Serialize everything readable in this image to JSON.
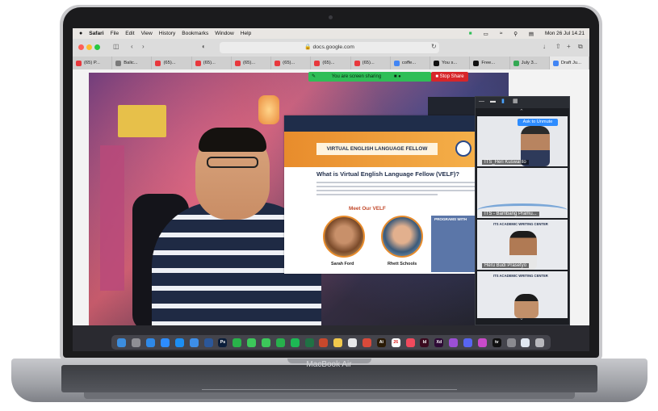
{
  "menubar": {
    "apple": "",
    "items": [
      "Safari",
      "File",
      "Edit",
      "View",
      "History",
      "Bookmarks",
      "Window",
      "Help"
    ],
    "datetime": "Mon 26 Jul  14.21"
  },
  "browser": {
    "url": "docs.google.com",
    "tabs": [
      {
        "label": "(65) P...",
        "icon_color": "#e8383d"
      },
      {
        "label": "Balic...",
        "icon_color": "#7a7a7a"
      },
      {
        "label": "(65)...",
        "icon_color": "#e8383d"
      },
      {
        "label": "(65)...",
        "icon_color": "#e8383d"
      },
      {
        "label": "(65)...",
        "icon_color": "#e8383d"
      },
      {
        "label": "(65)...",
        "icon_color": "#e8383d"
      },
      {
        "label": "(65)...",
        "icon_color": "#e8383d"
      },
      {
        "label": "(65)...",
        "icon_color": "#e8383d"
      },
      {
        "label": "coffe...",
        "icon_color": "#4285f4"
      },
      {
        "label": "You s...",
        "icon_color": "#111111"
      },
      {
        "label": "Free...",
        "icon_color": "#111111"
      },
      {
        "label": "July 3...",
        "icon_color": "#34a853"
      },
      {
        "label": "Draft Ju...",
        "icon_color": "#4285f4"
      }
    ]
  },
  "share": {
    "status": "You are screen sharing",
    "stop_label": "Stop Share"
  },
  "slide": {
    "banner_title": "VIRTUAL ENGLISH LANGUAGE FELLOW",
    "question": "What is Virtual English Language Fellow (VELF)?",
    "meet_heading": "Meet Our VELF",
    "fellows": [
      "Sarah Ford",
      "Rhett Schools"
    ],
    "programs_heading": "PROGRAMS WITH"
  },
  "zoom": {
    "ask_unmute": "Ask to Unmute",
    "participants": [
      {
        "name": "ITS_Heri Kuswanto"
      },
      {
        "name": "ITS - Bambang Pramu..."
      },
      {
        "name": "Heru Budi Prasetyo"
      },
      {
        "name": ""
      }
    ],
    "doc_title": "ITS ACADEMIC WRITING CENTER"
  },
  "dock": {
    "date_badge": "26",
    "apps": [
      {
        "name": "finder-icon",
        "label": "",
        "color": "#3c8dde"
      },
      {
        "name": "launchpad-icon",
        "label": "",
        "color": "#8f8f95"
      },
      {
        "name": "safari-icon",
        "label": "",
        "color": "#2f89e8"
      },
      {
        "name": "zoom-icon",
        "label": "",
        "color": "#2d8cff"
      },
      {
        "name": "appstore-icon",
        "label": "",
        "color": "#1c8ef2"
      },
      {
        "name": "mail-icon",
        "label": "",
        "color": "#3d8ee8"
      },
      {
        "name": "word-icon",
        "label": "",
        "color": "#2b579a"
      },
      {
        "name": "photoshop-icon",
        "label": "Ps",
        "color": "#0a1d3a"
      },
      {
        "name": "whatsapp-icon",
        "label": "",
        "color": "#29b34a"
      },
      {
        "name": "facetime-icon",
        "label": "",
        "color": "#3cc85a"
      },
      {
        "name": "messages-icon",
        "label": "",
        "color": "#3cc85a"
      },
      {
        "name": "line-icon",
        "label": "",
        "color": "#27b14c"
      },
      {
        "name": "spotify-icon",
        "label": "",
        "color": "#1db954"
      },
      {
        "name": "excel-icon",
        "label": "",
        "color": "#1f7244"
      },
      {
        "name": "powerpoint-icon",
        "label": "",
        "color": "#c7482c"
      },
      {
        "name": "notes-icon",
        "label": "",
        "color": "#f2c94c"
      },
      {
        "name": "app-icon-a",
        "label": "",
        "color": "#e8e8ea"
      },
      {
        "name": "app-icon-b",
        "label": "",
        "color": "#d94a3a"
      },
      {
        "name": "illustrator-icon",
        "label": "Ai",
        "color": "#2a1a05"
      },
      {
        "name": "calendar-icon",
        "label": "26",
        "color": "#ffffff"
      },
      {
        "name": "music-icon",
        "label": "",
        "color": "#f04a5d"
      },
      {
        "name": "indesign-icon",
        "label": "Id",
        "color": "#3a0a1f"
      },
      {
        "name": "xd-icon",
        "label": "Xd",
        "color": "#2e0a36"
      },
      {
        "name": "podcasts-icon",
        "label": "",
        "color": "#9c4fd6"
      },
      {
        "name": "discord-icon",
        "label": "",
        "color": "#5865f2"
      },
      {
        "name": "app-icon-c",
        "label": "",
        "color": "#c94ac9"
      },
      {
        "name": "tv-icon",
        "label": "tv",
        "color": "#111111"
      },
      {
        "name": "settings-icon",
        "label": "",
        "color": "#8a8a90"
      },
      {
        "name": "preview-icon",
        "label": "",
        "color": "#dfe6f0"
      },
      {
        "name": "trash-icon",
        "label": "",
        "color": "#b8b8bd"
      }
    ]
  },
  "device": {
    "label": "MacBook Air"
  }
}
